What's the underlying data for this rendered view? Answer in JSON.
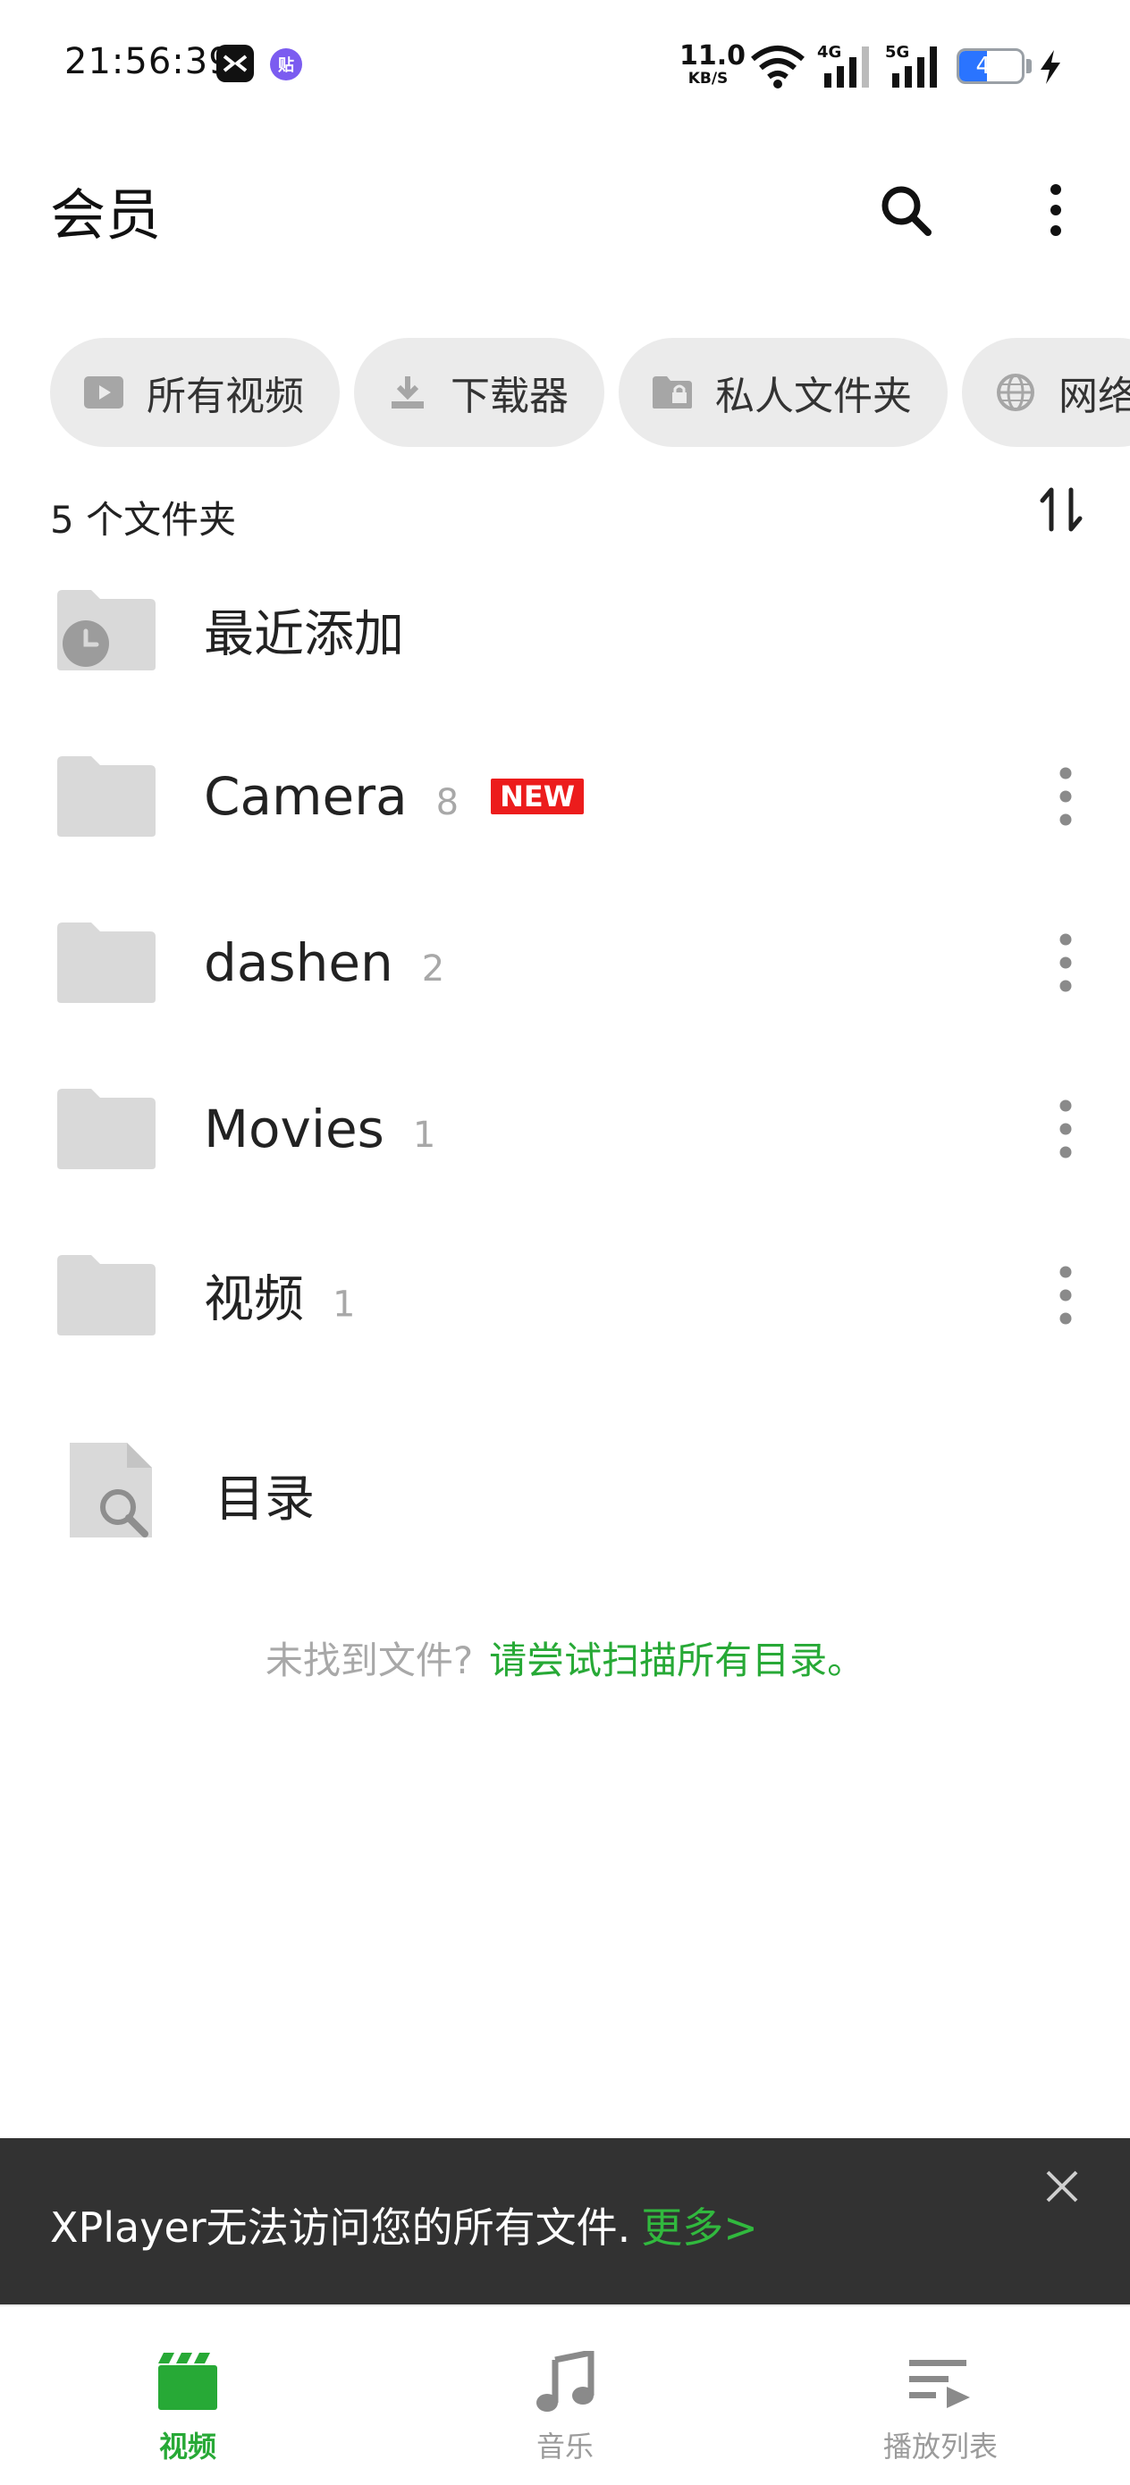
{
  "status_bar": {
    "time": "21:56:39",
    "app_icon_1": "capcut-icon",
    "app_icon_2_text": "贴",
    "net_speed_value": "11.0",
    "net_speed_unit": "KB/S",
    "signal_1_label": "4G",
    "signal_2_label": "5G",
    "battery": "44",
    "battery_level": 0.44,
    "charging": true
  },
  "header": {
    "title": "会员",
    "search_icon": "search-icon",
    "menu_icon": "more-vertical-icon"
  },
  "chips": [
    {
      "label": "所有视频",
      "icon": "video-play-icon"
    },
    {
      "label": "下载器",
      "icon": "download-icon"
    },
    {
      "label": "私人文件夹",
      "icon": "lock-folder-icon"
    },
    {
      "label": "网络",
      "icon": "globe-icon"
    }
  ],
  "folder_summary": {
    "count_label": "5 个文件夹",
    "sort_icon": "sort-icon"
  },
  "folders": [
    {
      "name": "最近添加",
      "count": "",
      "is_new": false,
      "icon": "recent-folder-icon"
    },
    {
      "name": "Camera",
      "count": "8",
      "is_new": true,
      "icon": "folder-icon"
    },
    {
      "name": "dashen",
      "count": "2",
      "is_new": false,
      "icon": "folder-icon"
    },
    {
      "name": "Movies",
      "count": "1",
      "is_new": false,
      "icon": "folder-icon"
    },
    {
      "name": "视频",
      "count": "1",
      "is_new": false,
      "icon": "folder-icon"
    }
  ],
  "new_badge": "NEW",
  "directory": {
    "label": "目录",
    "icon": "file-search-icon"
  },
  "hint": {
    "question": "未找到文件?",
    "link": "请尝试扫描所有目录。"
  },
  "snackbar": {
    "message": "XPlayer无法访问您的所有文件.",
    "link": "更多>",
    "close_icon": "close-icon"
  },
  "bottom_nav": [
    {
      "label": "视频",
      "icon": "clapperboard-icon",
      "active": true
    },
    {
      "label": "音乐",
      "icon": "music-note-icon",
      "active": false
    },
    {
      "label": "播放列表",
      "icon": "playlist-icon",
      "active": false
    }
  ],
  "colors": {
    "accent_green": "#27a936",
    "new_badge_red": "#ec1c1c",
    "snackbar_bg": "#323232",
    "chip_bg": "#ebebeb",
    "folder_grey": "#d9d9d9"
  }
}
